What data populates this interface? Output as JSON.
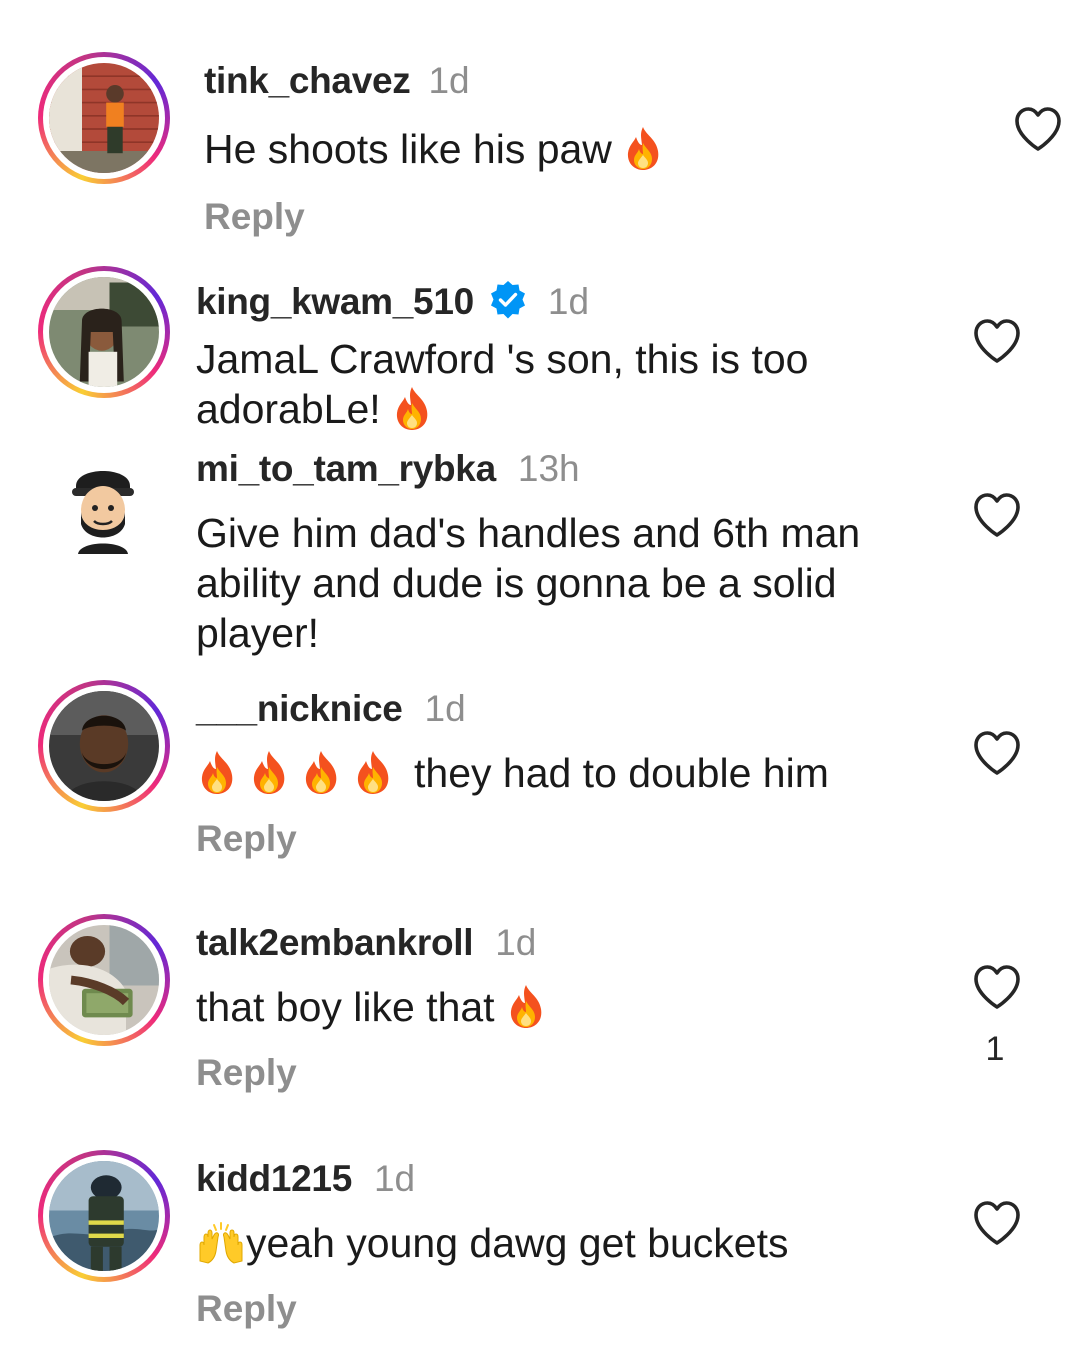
{
  "comments": [
    {
      "username": "tink_chavez",
      "time": "1d",
      "text": "He shoots like his paw",
      "reply_label": "Reply"
    },
    {
      "username": "king_kwam_510",
      "time": "1d",
      "verified": true,
      "text_line1": "JamaL Crawford 's son, this is too",
      "text_line2": "adorabLe!"
    },
    {
      "username": "mi_to_tam_rybka",
      "time": "13h",
      "text_line1": "Give him dad's handles and 6th man",
      "text_line2": "ability and dude is gonna be a solid",
      "text_line3": "player!"
    },
    {
      "username": "___nicknice",
      "time": "1d",
      "text": "they had to double him",
      "reply_label": "Reply"
    },
    {
      "username": "talk2embankroll",
      "time": "1d",
      "text": "that boy like that",
      "reply_label": "Reply",
      "like_count": "1"
    },
    {
      "username": "kidd1215",
      "time": "1d",
      "text": "yeah young dawg get buckets",
      "reply_label": "Reply"
    }
  ],
  "icons": {
    "like": "heart-outline-icon",
    "verified": "verified-badge-icon",
    "fire": "fire-emoji",
    "hands": "raised-hands-emoji"
  },
  "colors": {
    "verified_blue": "#0095f6",
    "muted_text": "#8e8e8e",
    "story_ring_start": "#f9ce34",
    "story_ring_end": "#ee2a7b"
  }
}
